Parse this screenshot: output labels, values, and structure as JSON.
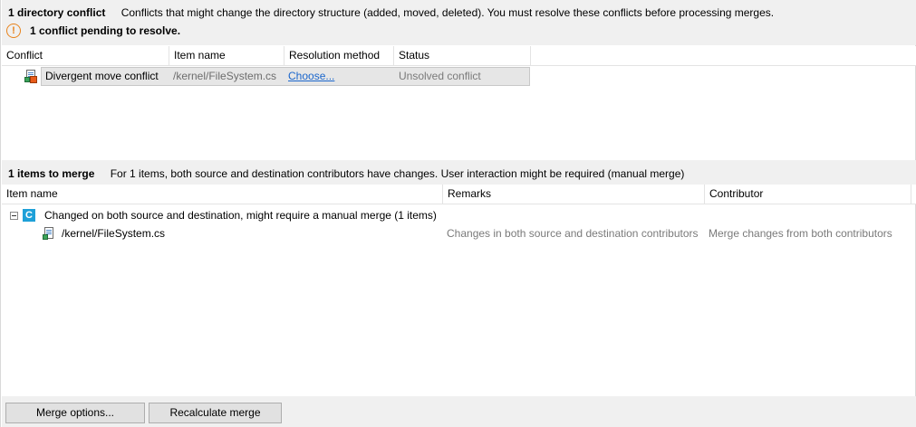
{
  "directory_conflicts": {
    "title": "1 directory conflict",
    "description": "Conflicts that might change the directory structure (added, moved, deleted). You must resolve these conflicts before processing merges.",
    "pending_text": "1 conflict pending to resolve.",
    "warning_icon": "warning-circle-icon",
    "columns": [
      "Conflict",
      "Item name",
      "Resolution method",
      "Status"
    ],
    "rows": [
      {
        "icon": "file-conflict-icon",
        "conflict": "Divergent move conflict",
        "item_name": "/kernel/FileSystem.cs",
        "resolution": "Choose...",
        "status": "Unsolved conflict"
      }
    ]
  },
  "merge": {
    "title": "1 items to merge",
    "description": "For 1 items, both source and destination contributors have changes. User interaction might be required (manual merge)",
    "columns": [
      "Item name",
      "Remarks",
      "Contributor"
    ],
    "groups": [
      {
        "badge": "C",
        "label": "Changed on both source and destination, might require a manual merge (1 items)",
        "items": [
          {
            "icon": "file-changed-icon",
            "name": "/kernel/FileSystem.cs",
            "remarks": "Changes in both source and destination contributors",
            "contributor": "Merge changes from both contributors"
          }
        ]
      }
    ]
  },
  "footer": {
    "merge_options_label": "Merge options...",
    "recalculate_label": "Recalculate merge"
  },
  "colors": {
    "header_bg": "#f0f0f0",
    "warning": "#e8821a",
    "link": "#1a66cc",
    "badge_c": "#1ea0d8"
  }
}
